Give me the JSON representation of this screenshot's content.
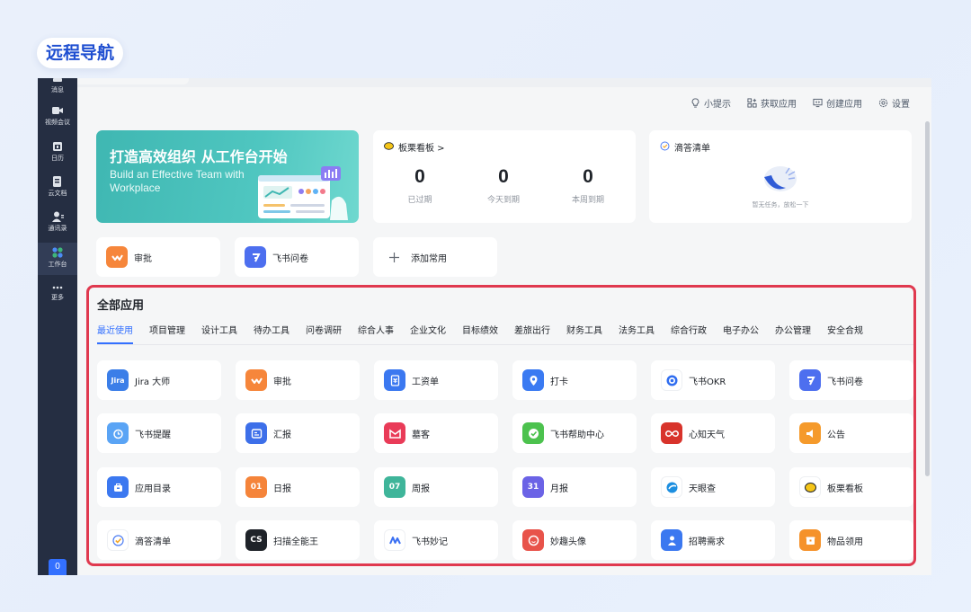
{
  "page_label": "远程导航",
  "sidebar": {
    "items": [
      {
        "label": "消息",
        "icon": "message-icon"
      },
      {
        "label": "视频会议",
        "icon": "video-icon"
      },
      {
        "label": "日历",
        "icon": "calendar-icon"
      },
      {
        "label": "云文档",
        "icon": "docs-icon"
      },
      {
        "label": "通讯录",
        "icon": "contacts-icon"
      },
      {
        "label": "工作台",
        "icon": "workplace-icon"
      },
      {
        "label": "更多",
        "icon": "more-icon"
      }
    ],
    "badge": "0"
  },
  "toolbar": {
    "tips": "小提示",
    "get_apps": "获取应用",
    "create_app": "创建应用",
    "settings": "设置"
  },
  "banner": {
    "title": "打造高效组织 从工作台开始",
    "subtitle": "Build an Effective Team with Workplace"
  },
  "kanban": {
    "title": "板栗看板 >",
    "stats": [
      {
        "value": "0",
        "label": "已过期"
      },
      {
        "value": "0",
        "label": "今天到期"
      },
      {
        "value": "0",
        "label": "本周到期"
      }
    ]
  },
  "todo": {
    "title": "滴答清单",
    "empty": "暂无任务，放松一下"
  },
  "quick_apps": [
    {
      "label": "审批",
      "icon": "approval-icon",
      "color": "#f6863b"
    },
    {
      "label": "飞书问卷",
      "icon": "survey-icon",
      "color": "#4d6fef"
    },
    {
      "label": "添加常用",
      "icon": "plus-icon",
      "color": "#ffffff"
    }
  ],
  "section": {
    "title": "全部应用",
    "tabs": [
      "最近使用",
      "项目管理",
      "设计工具",
      "待办工具",
      "问卷调研",
      "综合人事",
      "企业文化",
      "目标绩效",
      "差旅出行",
      "财务工具",
      "法务工具",
      "综合行政",
      "电子办公",
      "办公管理",
      "安全合规"
    ],
    "apps": [
      {
        "label": "Jira 大师",
        "icon": "jira-icon",
        "color": "#3b7ee8",
        "glyph": "Jira"
      },
      {
        "label": "审批",
        "icon": "approval-icon",
        "color": "#f6863b",
        "glyph": ""
      },
      {
        "label": "工资单",
        "icon": "payroll-icon",
        "color": "#3b78f0",
        "glyph": "¥"
      },
      {
        "label": "打卡",
        "icon": "checkin-icon",
        "color": "#3a7af2",
        "glyph": ""
      },
      {
        "label": "飞书OKR",
        "icon": "okr-icon",
        "color": "#ffffff",
        "glyph": ""
      },
      {
        "label": "飞书问卷",
        "icon": "survey-icon",
        "color": "#4d6fef",
        "glyph": ""
      },
      {
        "label": "飞书提醒",
        "icon": "reminder-icon",
        "color": "#5aa4f5",
        "glyph": ""
      },
      {
        "label": "汇报",
        "icon": "report-icon",
        "color": "#3d6fe9",
        "glyph": ""
      },
      {
        "label": "墓客",
        "icon": "mooc-icon",
        "color": "#e93b58",
        "glyph": ""
      },
      {
        "label": "飞书帮助中心",
        "icon": "help-center-icon",
        "color": "#4cc24e",
        "glyph": ""
      },
      {
        "label": "心知天气",
        "icon": "weather-icon",
        "color": "#d8332b",
        "glyph": ""
      },
      {
        "label": "公告",
        "icon": "announcement-icon",
        "color": "#f59a2b",
        "glyph": ""
      },
      {
        "label": "应用目录",
        "icon": "app-directory-icon",
        "color": "#3b78f0",
        "glyph": ""
      },
      {
        "label": "日报",
        "icon": "daily-report-icon",
        "color": "#f5843a",
        "glyph": "01"
      },
      {
        "label": "周报",
        "icon": "weekly-report-icon",
        "color": "#3fb59a",
        "glyph": "07"
      },
      {
        "label": "月报",
        "icon": "monthly-report-icon",
        "color": "#6b63e6",
        "glyph": "31"
      },
      {
        "label": "天眼查",
        "icon": "tianyancha-icon",
        "color": "#ffffff",
        "glyph": ""
      },
      {
        "label": "板栗看板",
        "icon": "kanban-icon",
        "color": "#ffffff",
        "glyph": ""
      },
      {
        "label": "滴答清单",
        "icon": "ticktick-icon",
        "color": "#ffffff",
        "glyph": ""
      },
      {
        "label": "扫描全能王",
        "icon": "camscanner-icon",
        "color": "#1f2329",
        "glyph": "CS"
      },
      {
        "label": "飞书妙记",
        "icon": "minutes-icon",
        "color": "#ffffff",
        "glyph": ""
      },
      {
        "label": "妙趣头像",
        "icon": "avatar-app-icon",
        "color": "#e8534a",
        "glyph": ""
      },
      {
        "label": "招聘需求",
        "icon": "recruit-icon",
        "color": "#3b78f0",
        "glyph": ""
      },
      {
        "label": "物品领用",
        "icon": "item-claim-icon",
        "color": "#f5922b",
        "glyph": ""
      }
    ]
  },
  "colors": {
    "accent": "#3370ff",
    "sidebar_bg": "#252e42",
    "highlight_frame": "#e0394f",
    "banner": "#4fc6c0"
  }
}
